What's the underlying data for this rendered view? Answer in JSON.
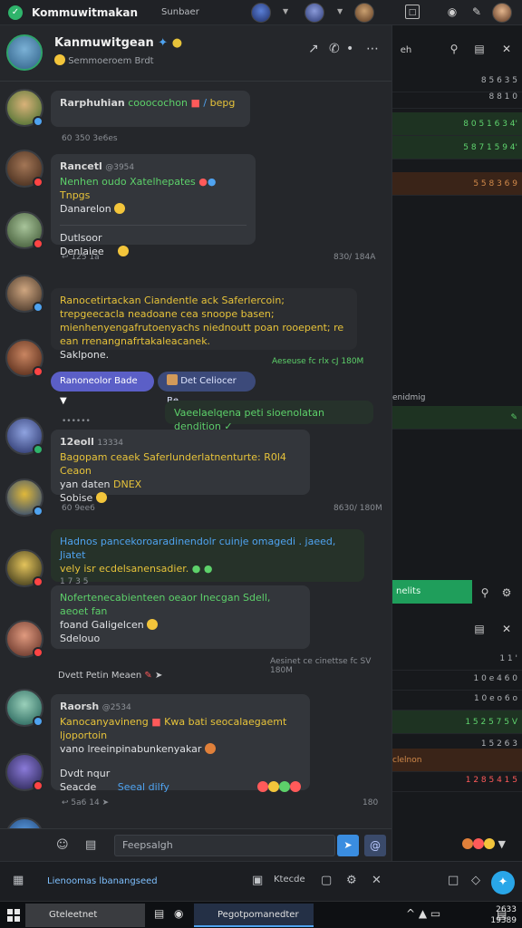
{
  "app": {
    "title": "Kommuwitmakan",
    "subtitle": "Sunbaer"
  },
  "chat": {
    "title": "Kanmuwitgean",
    "subtitle": "Semmoeroem Brdt"
  },
  "messages": [
    {
      "author": "Rarphuhian",
      "text": "cooocochon",
      "tag": "bepg",
      "time": "60  350  3e6es"
    },
    {
      "author": "Rancetl",
      "time": "@3954",
      "text": "Nenhen oudo Xatelhepates",
      "tag": "Tnpgs",
      "line2": "Danarelon",
      "line3": "Dutlsoor",
      "line4": "Denlaiee",
      "meta": "125  1a",
      "metaR": "830/  184A"
    },
    {
      "text": "Ranocetirtackan Ciandentle ack Saferlercoin; trepgeecacla neadoane cea snoope basen; mienhenyengafrutoenyachs niednoutt poan rooepent; re ean rrenangnafrtakaleacanek.",
      "tail": "Saklpone.",
      "time": "Aeseuse fc rlx cJ  180M"
    },
    {
      "author": "Ranoneolor Bade"
    },
    {
      "author": "Det Celiocer Be"
    },
    {
      "text": "Vaeelaelqena peti sioenolatan dendition"
    },
    {
      "author": "12eoll",
      "time": "13334",
      "text": "Bagopam ceaek Saferlunderlatnenturte: R0l4 Ceaon",
      "line2": "yan daten",
      "tag": "DNEX",
      "line3": "Sobise"
    },
    {
      "meta": "60  9ee6",
      "metaR": "8630/  180M"
    },
    {
      "text": "Hadnos pancekoroaradinendolr cuinje omagedi . jaeed, Jiatet",
      "line2": "vely isr ecdelsanensadier.",
      "line3": "1 7 3 5"
    },
    {
      "text": "Nofertenecabienteen oeaor Inecgan Sdell, aeoet fan",
      "line2": "foand Galigelcen",
      "line3": "Sdelouo"
    },
    {
      "time": "Aesinet ce cinettse fc SV  180M"
    },
    {
      "text": "Dvett Petin Meaen"
    },
    {
      "author": "Raorsh",
      "time": "@2534",
      "text": "Kanocanyavineng",
      "tag": "Kwa bati seocalaegaemt ljoportoin",
      "line2": "vano lreeinpinabunkenyakar",
      "line3": "Dvdt nqur",
      "line4": "Seacde",
      "line5": "Seeal dilfy"
    },
    {
      "meta": "5a6  14",
      "metaR": "180"
    }
  ],
  "chips": {
    "left": "Ranoneolor Bade",
    "right": "Det Celiocer Be"
  },
  "composer": {
    "placeholder": "Feepsalgh"
  },
  "right": {
    "rows": [
      {
        "label": "",
        "value": "8 5 6  3 5"
      },
      {
        "label": "",
        "value": "8 8  1 0"
      },
      {
        "label": "",
        "value": "8 0 5 1 6 3 4'"
      },
      {
        "label": "",
        "value": "5 8 7 1 5 9 4'"
      },
      {
        "label": "",
        "value": "5 5 8 3 6 9"
      },
      {
        "label": "enidmig",
        "value": ""
      },
      {
        "label": "nelits",
        "value": ""
      }
    ],
    "rows2": [
      {
        "label": "",
        "value": "1 1 '"
      },
      {
        "label": "",
        "value": "1 0 e 4 6 0"
      },
      {
        "label": "",
        "value": "1 0 e o 6 o"
      },
      {
        "label": "",
        "value": "1 5 2 5 7 5 V"
      },
      {
        "label": "",
        "value": "1 5 2 6 3"
      },
      {
        "label": "clelnon",
        "value": ""
      },
      {
        "label": "",
        "value": "1 2 8 5 4 1 5"
      }
    ]
  },
  "strip": {
    "text": "Lienoomas lbanangseed"
  },
  "taskbar": {
    "item1": "Gteleetnet",
    "item2": "Pegotpomanedter",
    "clock_time": "2633",
    "clock_date": "19389"
  }
}
